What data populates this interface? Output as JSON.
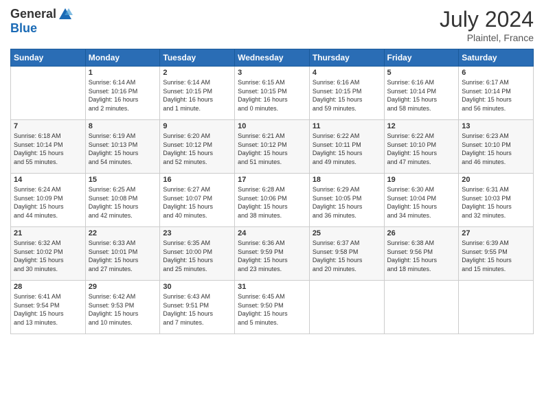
{
  "header": {
    "logo_general": "General",
    "logo_blue": "Blue",
    "month_year": "July 2024",
    "location": "Plaintel, France"
  },
  "calendar": {
    "days_of_week": [
      "Sunday",
      "Monday",
      "Tuesday",
      "Wednesday",
      "Thursday",
      "Friday",
      "Saturday"
    ],
    "weeks": [
      [
        {
          "day": "",
          "info": ""
        },
        {
          "day": "1",
          "info": "Sunrise: 6:14 AM\nSunset: 10:16 PM\nDaylight: 16 hours\nand 2 minutes."
        },
        {
          "day": "2",
          "info": "Sunrise: 6:14 AM\nSunset: 10:15 PM\nDaylight: 16 hours\nand 1 minute."
        },
        {
          "day": "3",
          "info": "Sunrise: 6:15 AM\nSunset: 10:15 PM\nDaylight: 16 hours\nand 0 minutes."
        },
        {
          "day": "4",
          "info": "Sunrise: 6:16 AM\nSunset: 10:15 PM\nDaylight: 15 hours\nand 59 minutes."
        },
        {
          "day": "5",
          "info": "Sunrise: 6:16 AM\nSunset: 10:14 PM\nDaylight: 15 hours\nand 58 minutes."
        },
        {
          "day": "6",
          "info": "Sunrise: 6:17 AM\nSunset: 10:14 PM\nDaylight: 15 hours\nand 56 minutes."
        }
      ],
      [
        {
          "day": "7",
          "info": "Sunrise: 6:18 AM\nSunset: 10:14 PM\nDaylight: 15 hours\nand 55 minutes."
        },
        {
          "day": "8",
          "info": "Sunrise: 6:19 AM\nSunset: 10:13 PM\nDaylight: 15 hours\nand 54 minutes."
        },
        {
          "day": "9",
          "info": "Sunrise: 6:20 AM\nSunset: 10:12 PM\nDaylight: 15 hours\nand 52 minutes."
        },
        {
          "day": "10",
          "info": "Sunrise: 6:21 AM\nSunset: 10:12 PM\nDaylight: 15 hours\nand 51 minutes."
        },
        {
          "day": "11",
          "info": "Sunrise: 6:22 AM\nSunset: 10:11 PM\nDaylight: 15 hours\nand 49 minutes."
        },
        {
          "day": "12",
          "info": "Sunrise: 6:22 AM\nSunset: 10:10 PM\nDaylight: 15 hours\nand 47 minutes."
        },
        {
          "day": "13",
          "info": "Sunrise: 6:23 AM\nSunset: 10:10 PM\nDaylight: 15 hours\nand 46 minutes."
        }
      ],
      [
        {
          "day": "14",
          "info": "Sunrise: 6:24 AM\nSunset: 10:09 PM\nDaylight: 15 hours\nand 44 minutes."
        },
        {
          "day": "15",
          "info": "Sunrise: 6:25 AM\nSunset: 10:08 PM\nDaylight: 15 hours\nand 42 minutes."
        },
        {
          "day": "16",
          "info": "Sunrise: 6:27 AM\nSunset: 10:07 PM\nDaylight: 15 hours\nand 40 minutes."
        },
        {
          "day": "17",
          "info": "Sunrise: 6:28 AM\nSunset: 10:06 PM\nDaylight: 15 hours\nand 38 minutes."
        },
        {
          "day": "18",
          "info": "Sunrise: 6:29 AM\nSunset: 10:05 PM\nDaylight: 15 hours\nand 36 minutes."
        },
        {
          "day": "19",
          "info": "Sunrise: 6:30 AM\nSunset: 10:04 PM\nDaylight: 15 hours\nand 34 minutes."
        },
        {
          "day": "20",
          "info": "Sunrise: 6:31 AM\nSunset: 10:03 PM\nDaylight: 15 hours\nand 32 minutes."
        }
      ],
      [
        {
          "day": "21",
          "info": "Sunrise: 6:32 AM\nSunset: 10:02 PM\nDaylight: 15 hours\nand 30 minutes."
        },
        {
          "day": "22",
          "info": "Sunrise: 6:33 AM\nSunset: 10:01 PM\nDaylight: 15 hours\nand 27 minutes."
        },
        {
          "day": "23",
          "info": "Sunrise: 6:35 AM\nSunset: 10:00 PM\nDaylight: 15 hours\nand 25 minutes."
        },
        {
          "day": "24",
          "info": "Sunrise: 6:36 AM\nSunset: 9:59 PM\nDaylight: 15 hours\nand 23 minutes."
        },
        {
          "day": "25",
          "info": "Sunrise: 6:37 AM\nSunset: 9:58 PM\nDaylight: 15 hours\nand 20 minutes."
        },
        {
          "day": "26",
          "info": "Sunrise: 6:38 AM\nSunset: 9:56 PM\nDaylight: 15 hours\nand 18 minutes."
        },
        {
          "day": "27",
          "info": "Sunrise: 6:39 AM\nSunset: 9:55 PM\nDaylight: 15 hours\nand 15 minutes."
        }
      ],
      [
        {
          "day": "28",
          "info": "Sunrise: 6:41 AM\nSunset: 9:54 PM\nDaylight: 15 hours\nand 13 minutes."
        },
        {
          "day": "29",
          "info": "Sunrise: 6:42 AM\nSunset: 9:53 PM\nDaylight: 15 hours\nand 10 minutes."
        },
        {
          "day": "30",
          "info": "Sunrise: 6:43 AM\nSunset: 9:51 PM\nDaylight: 15 hours\nand 7 minutes."
        },
        {
          "day": "31",
          "info": "Sunrise: 6:45 AM\nSunset: 9:50 PM\nDaylight: 15 hours\nand 5 minutes."
        },
        {
          "day": "",
          "info": ""
        },
        {
          "day": "",
          "info": ""
        },
        {
          "day": "",
          "info": ""
        }
      ]
    ]
  }
}
